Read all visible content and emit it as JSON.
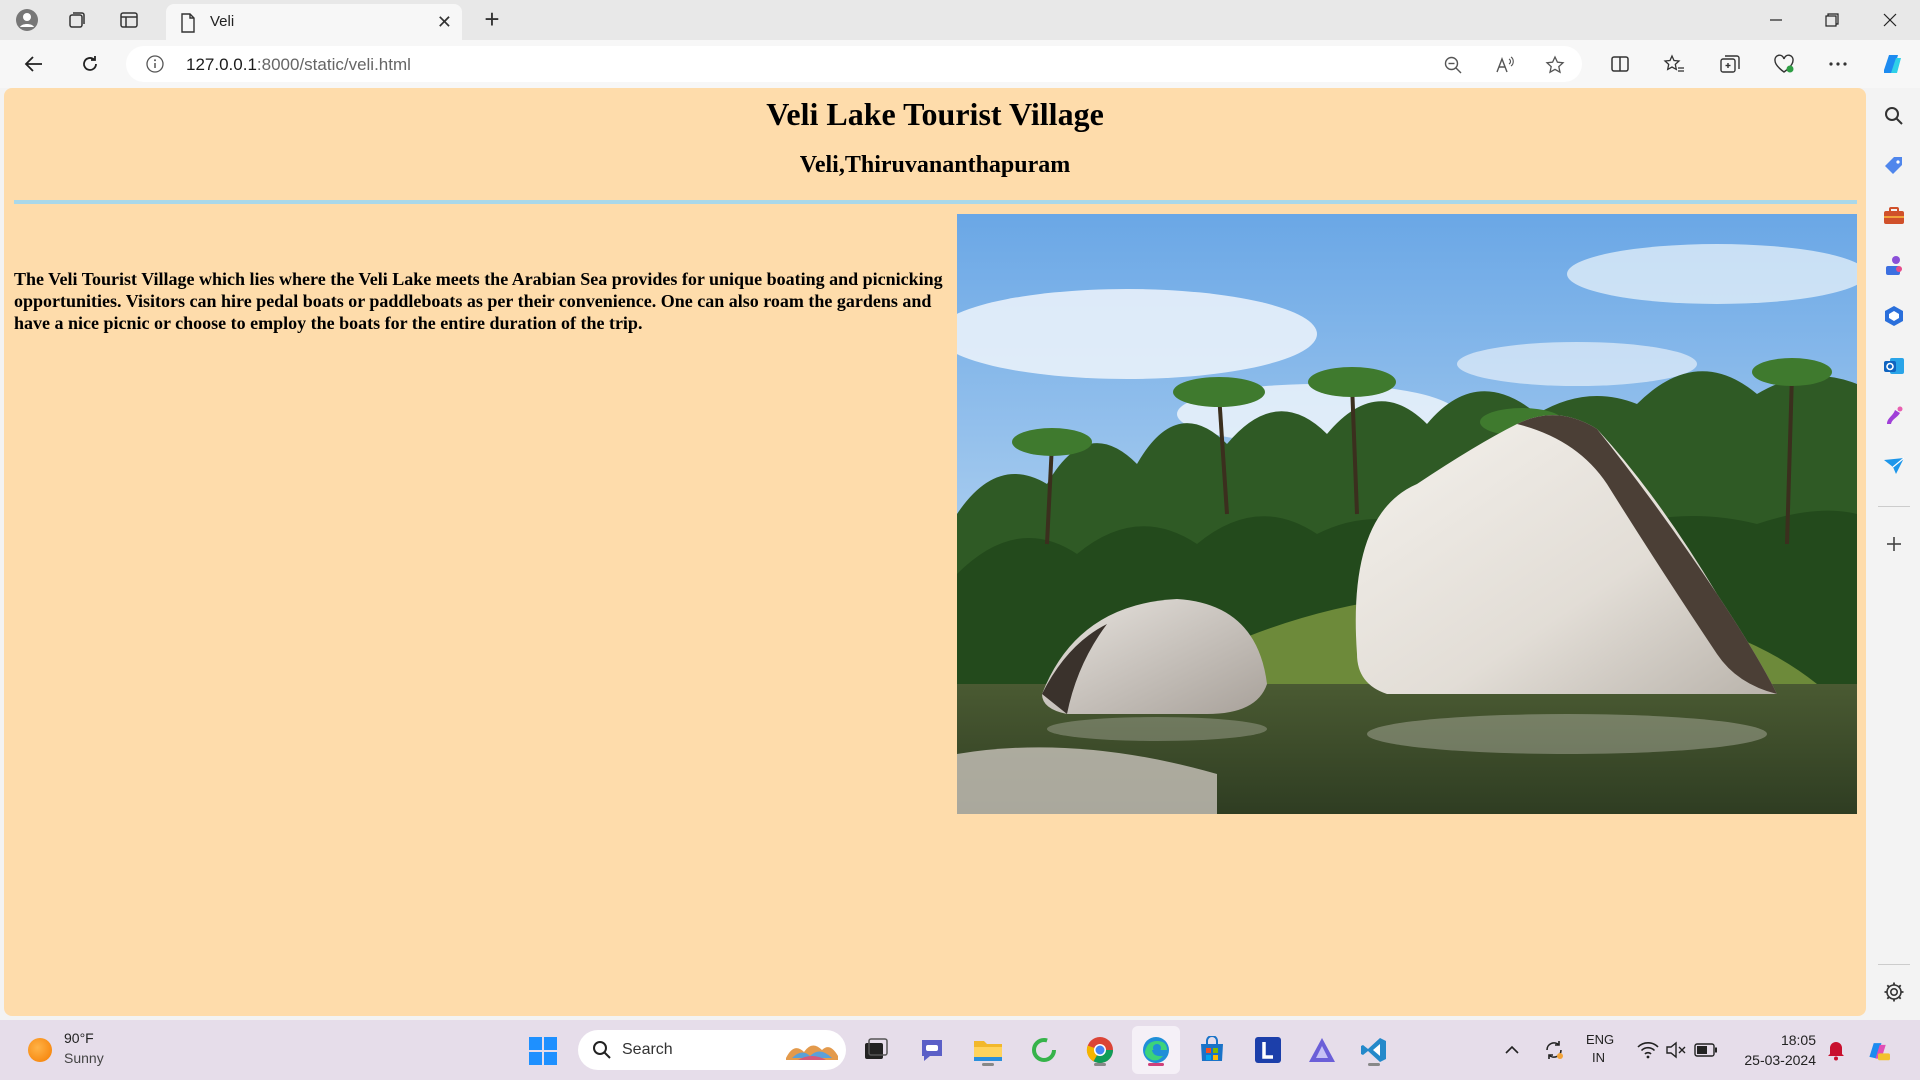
{
  "browser": {
    "tab_title": "Veli",
    "url_host": "127.0.0.1",
    "url_path": ":8000/static/veli.html"
  },
  "page": {
    "heading": "Veli Lake Tourist Village",
    "subheading": "Veli,Thiruvananthapuram",
    "description": "The Veli Tourist Village which lies where the Veli Lake meets the Arabian Sea provides for unique boating and picnicking opportunities. Visitors can hire pedal boats or paddleboats as per their convenience. One can also roam the gardens and have a nice picnic or choose to employ the boats for the entire duration of the trip.",
    "bg_color": "#fedcab",
    "rule_color": "#a9d8ea"
  },
  "taskbar": {
    "weather_temp": "90°F",
    "weather_cond": "Sunny",
    "search_label": "Search",
    "lang_line1": "ENG",
    "lang_line2": "IN",
    "time": "18:05",
    "date": "25-03-2024"
  }
}
